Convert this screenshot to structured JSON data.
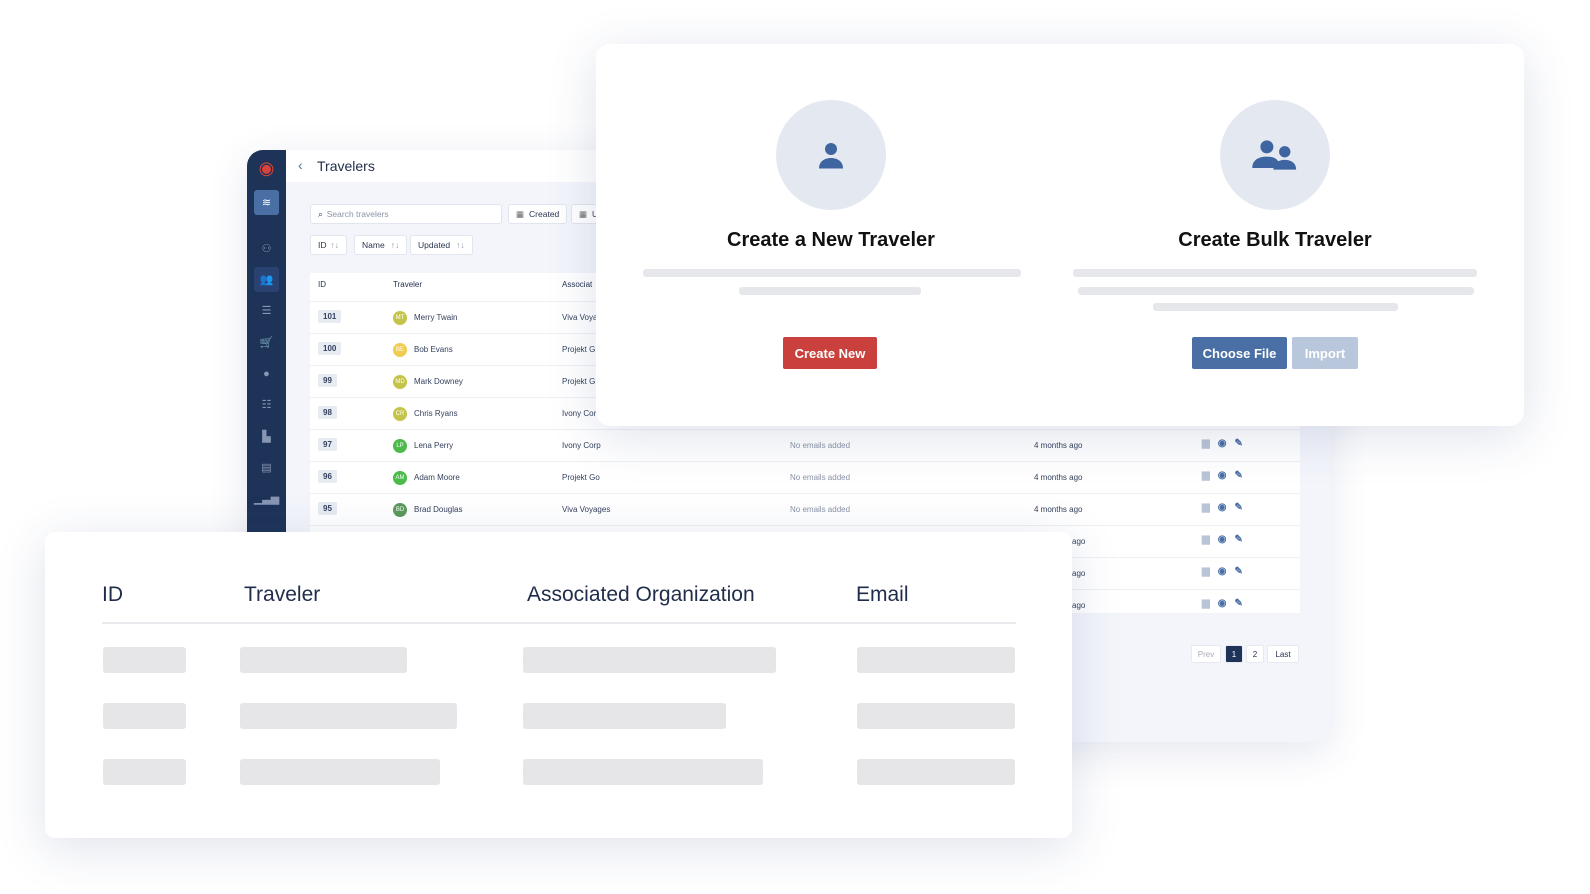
{
  "app": {
    "title": "Travelers",
    "search_placeholder": "Search travelers",
    "filters": [
      "Created",
      "U"
    ],
    "sorts": [
      "ID",
      "Name",
      "Updated"
    ],
    "columns": [
      "ID",
      "Traveler",
      "Associat"
    ],
    "rows": [
      {
        "id": "101",
        "initials": "MT",
        "name": "Merry Twain",
        "org": "Viva Voya",
        "color": "#c4c44a"
      },
      {
        "id": "100",
        "initials": "BE",
        "name": "Bob Evans",
        "org": "Projekt G",
        "color": "#f0cc50"
      },
      {
        "id": "99",
        "initials": "MD",
        "name": "Mark Downey",
        "org": "Projekt G",
        "color": "#c4c44a"
      },
      {
        "id": "98",
        "initials": "CR",
        "name": "Chris Ryans",
        "org": "Ivony Cor",
        "color": "#c4c44a"
      },
      {
        "id": "97",
        "initials": "LP",
        "name": "Lena Perry",
        "org": "Ivony Corp",
        "email": "No emails added",
        "updated": "4 months ago",
        "color": "#4cba4c"
      },
      {
        "id": "96",
        "initials": "AM",
        "name": "Adam Moore",
        "org": "Projekt Go",
        "email": "No emails added",
        "updated": "4 months ago",
        "color": "#4cba4c"
      },
      {
        "id": "95",
        "initials": "BD",
        "name": "Brad Douglas",
        "org": "Viva Voyages",
        "email": "No emails added",
        "updated": "4 months ago",
        "color": "#5a9a5a"
      },
      {
        "updated": "ago"
      },
      {
        "updated": "ago"
      },
      {
        "updated": "ago"
      }
    ],
    "pagination": {
      "prev": "Prev",
      "pages": [
        "1",
        "2"
      ],
      "last": "Last",
      "current": "1"
    }
  },
  "modal": {
    "new": {
      "title": "Create a New Traveler",
      "button": "Create New"
    },
    "bulk": {
      "title": "Create Bulk Traveler",
      "choose": "Choose File",
      "import": "Import"
    }
  },
  "bottom": {
    "columns": [
      "ID",
      "Traveler",
      "Associated Organization",
      "Email"
    ]
  },
  "colors": {
    "sidebar": "#1e3358",
    "primary": "#4a6fa5",
    "danger": "#c9403c",
    "disabled": "#b9c7dc"
  }
}
